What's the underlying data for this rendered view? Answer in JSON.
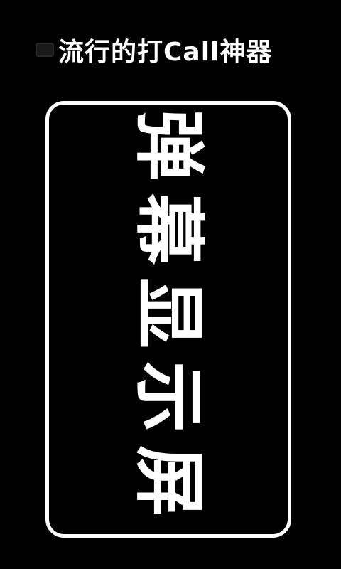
{
  "header": {
    "icon": "ticket-icon",
    "title": "流行的打Call神器"
  },
  "display": {
    "text": "弹幕显示屏"
  },
  "colors": {
    "background": "#000000",
    "foreground": "#ffffff"
  }
}
